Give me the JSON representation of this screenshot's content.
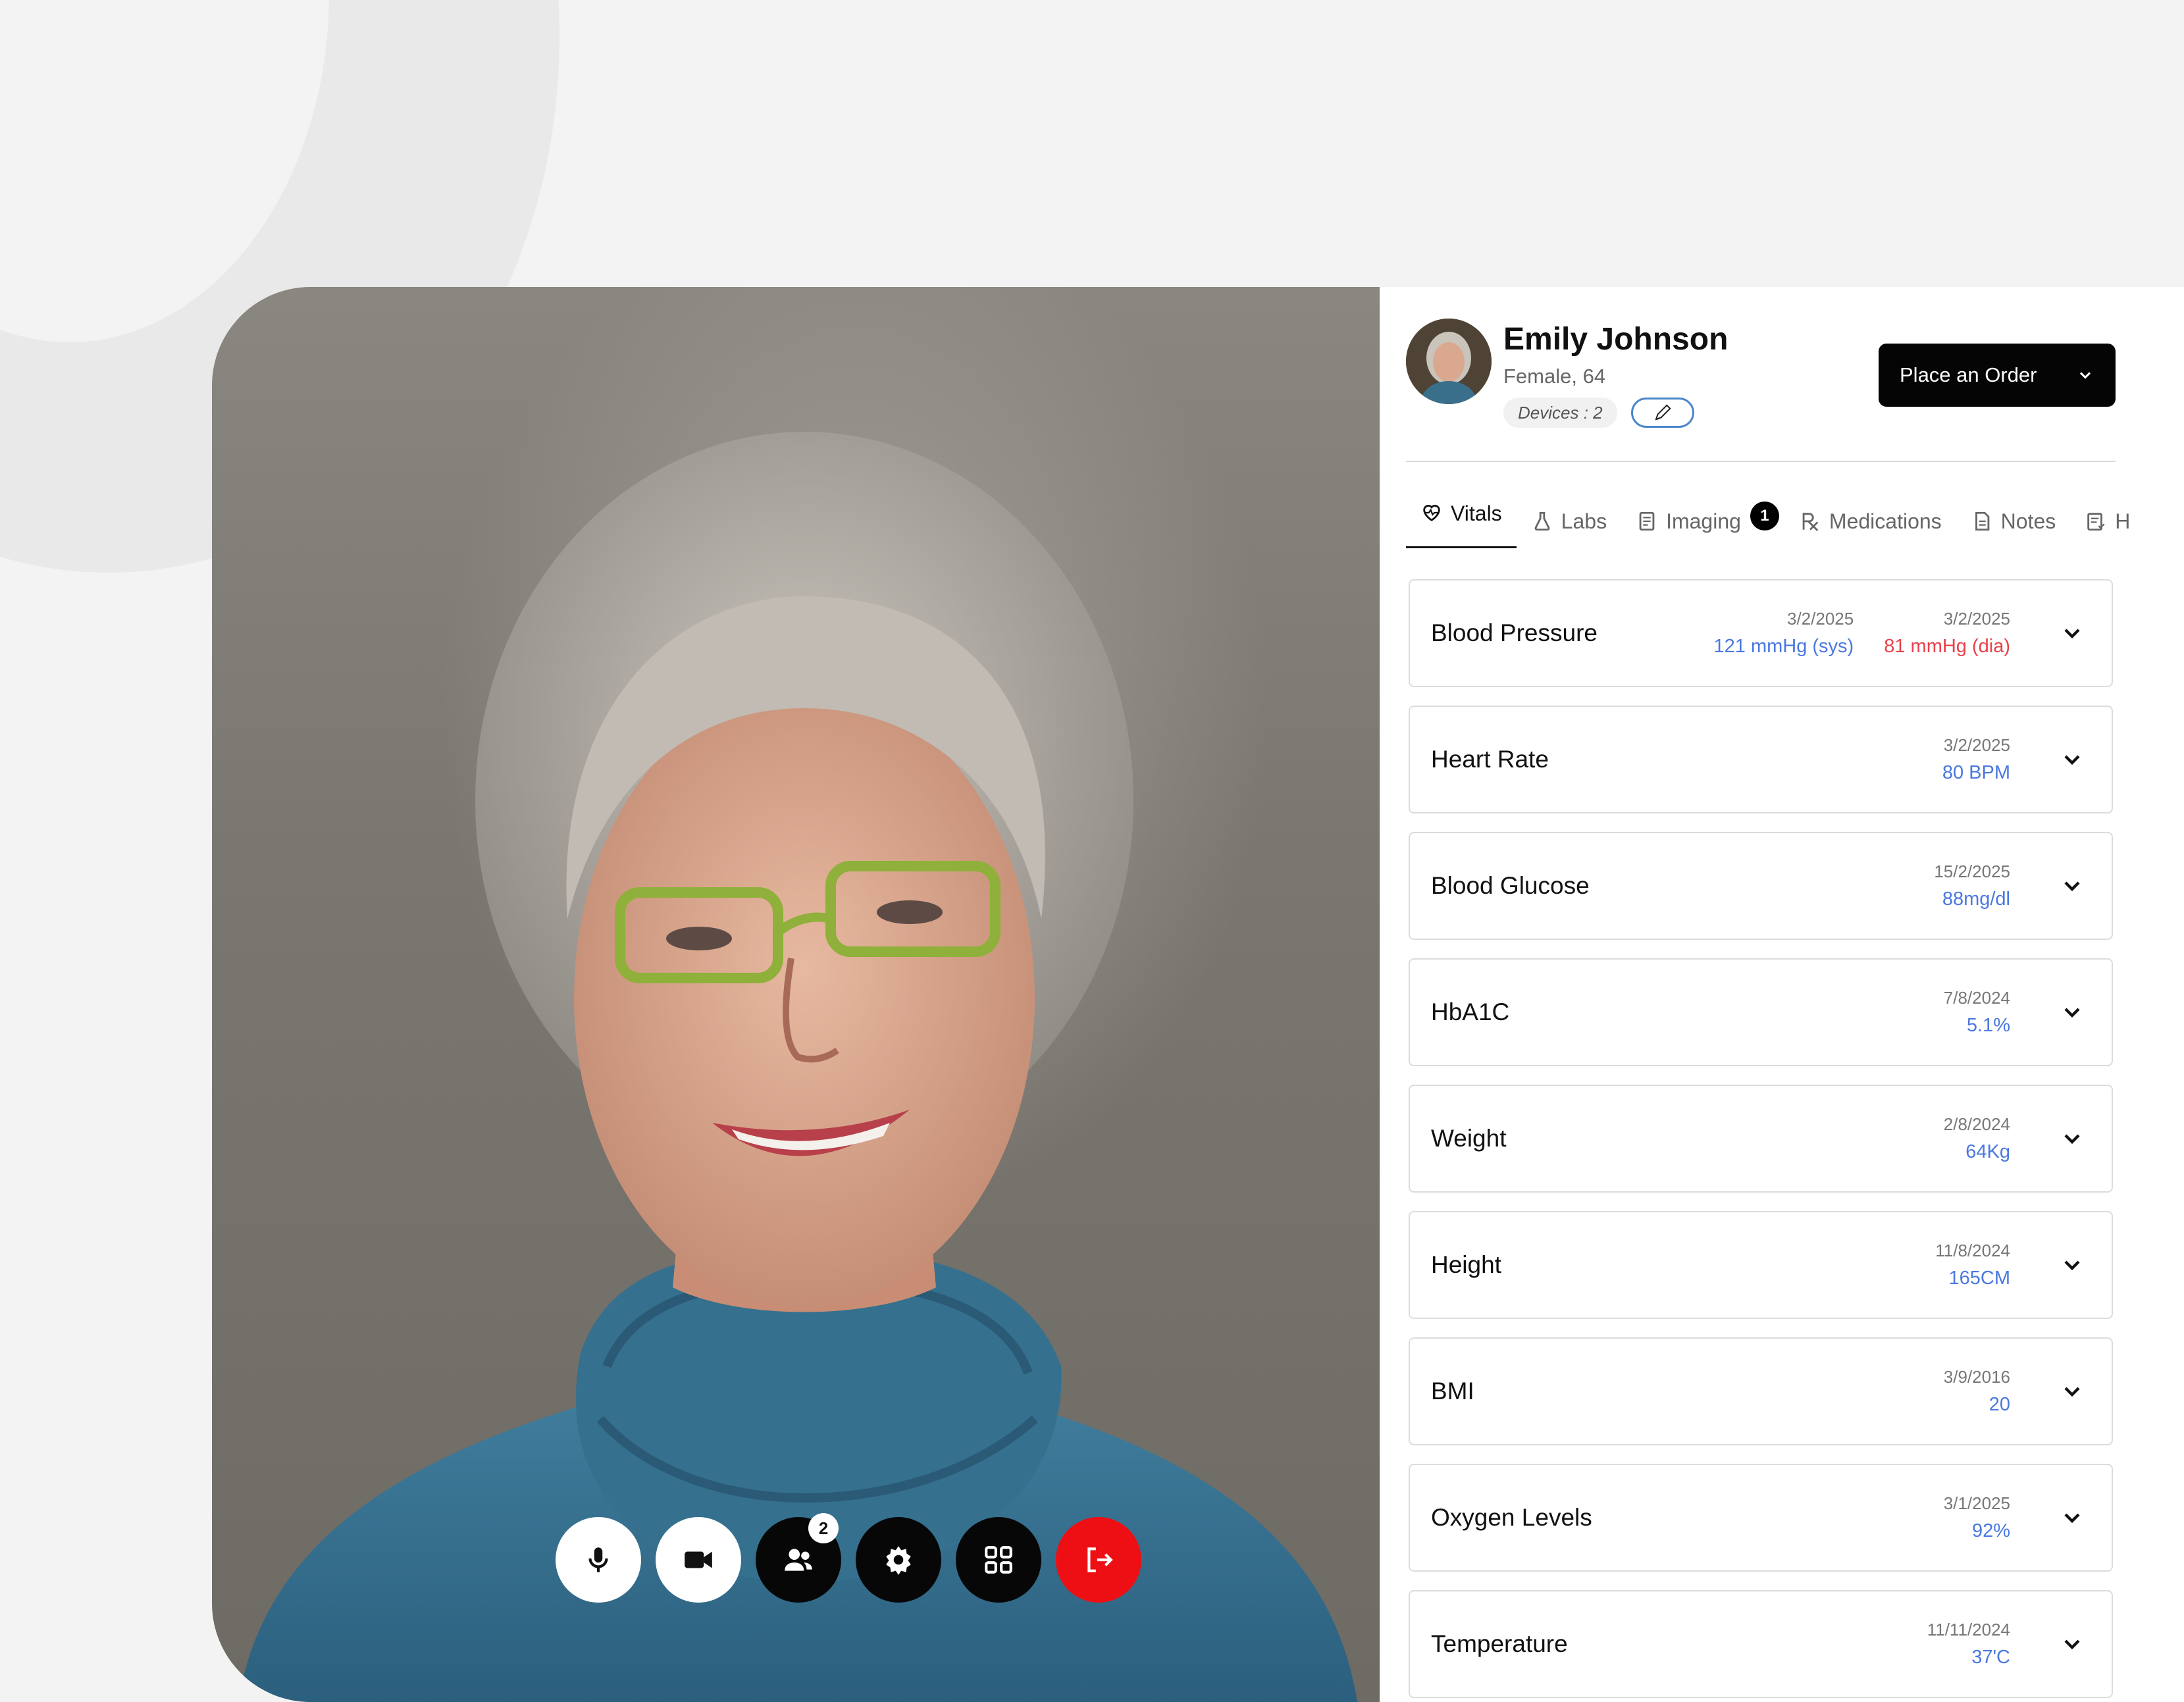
{
  "patient": {
    "name": "Emily Johnson",
    "meta": "Female, 64",
    "devices": "Devices : 2"
  },
  "order_button": {
    "label": "Place an Order"
  },
  "tabs": [
    {
      "label": "Vitals",
      "icon": "heart-pulse-icon",
      "active": true
    },
    {
      "label": "Labs",
      "icon": "flask-icon"
    },
    {
      "label": "Imaging",
      "icon": "document-icon",
      "badge": "1"
    },
    {
      "label": "Medications",
      "icon": "rx-icon"
    },
    {
      "label": "Notes",
      "icon": "notes-icon"
    },
    {
      "label": "H",
      "icon": "history-icon"
    }
  ],
  "vitals": [
    {
      "name": "Blood Pressure",
      "readings": [
        {
          "date": "3/2/2025",
          "value": "121 mmHg (sys)",
          "color": "#4a78e0"
        },
        {
          "date": "3/2/2025",
          "value": "81 mmHg (dia)",
          "color": "#e8404a"
        }
      ]
    },
    {
      "name": "Heart Rate",
      "readings": [
        {
          "date": "3/2/2025",
          "value": "80 BPM"
        }
      ]
    },
    {
      "name": "Blood Glucose",
      "readings": [
        {
          "date": "15/2/2025",
          "value": "88mg/dl"
        }
      ]
    },
    {
      "name": "HbA1C",
      "readings": [
        {
          "date": "7/8/2024",
          "value": "5.1%"
        }
      ]
    },
    {
      "name": "Weight",
      "readings": [
        {
          "date": "2/8/2024",
          "value": "64Kg"
        }
      ]
    },
    {
      "name": "Height",
      "readings": [
        {
          "date": "11/8/2024",
          "value": "165CM"
        }
      ]
    },
    {
      "name": "BMI",
      "readings": [
        {
          "date": "3/9/2016",
          "value": "20"
        }
      ]
    },
    {
      "name": "Oxygen Levels",
      "readings": [
        {
          "date": "3/1/2025",
          "value": "92%"
        }
      ]
    },
    {
      "name": "Temperature",
      "readings": [
        {
          "date": "11/11/2024",
          "value": "37'C"
        }
      ]
    }
  ],
  "call_controls": {
    "participants_count": "2",
    "buttons": [
      "microphone-icon",
      "video-camera-icon",
      "participants-icon",
      "settings-icon",
      "grid-layout-icon",
      "leave-call-icon"
    ],
    "leave_color": "#ee0f14"
  },
  "colors": {
    "accent_blue": "#4a78e0",
    "alert_red": "#e8404a",
    "edit_border": "#4a86c8"
  }
}
